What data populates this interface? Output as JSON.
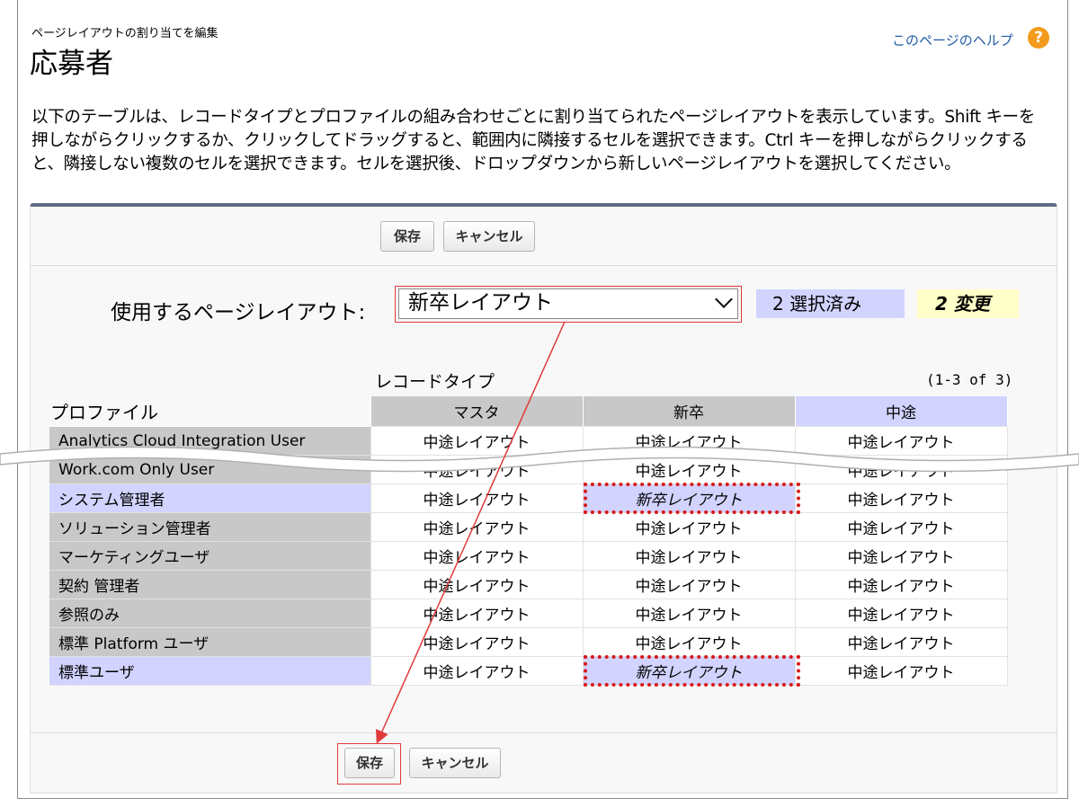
{
  "header": {
    "breadcrumb": "ページレイアウトの割り当てを編集",
    "title": "応募者",
    "help_link": "このページのヘルプ",
    "help_icon": "?"
  },
  "description": "以下のテーブルは、レコードタイプとプロファイルの組み合わせごとに割り当てられたページレイアウトを表示しています。Shift キーを押しながらクリックするか、クリックしてドラッグすると、範囲内に隣接するセルを選択できます。Ctrl キーを押しながらクリックすると、隣接しない複数のセルを選択できます。セルを選択後、ドロップダウンから新しいページレイアウトを選択してください。",
  "buttons": {
    "save": "保存",
    "cancel": "キャンセル"
  },
  "layout_select": {
    "label": "使用するページレイアウト:",
    "value": "新卒レイアウト",
    "selected_badge": "2 選択済み",
    "changed_badge": "2 変更"
  },
  "grid": {
    "record_type_label": "レコードタイプ",
    "count_label": "(1-3 of 3)",
    "profile_header": "プロファイル",
    "columns": [
      "マスタ",
      "新卒",
      "中途"
    ],
    "rows": [
      {
        "profile": "Analytics Cloud Integration User",
        "cells": [
          "中途レイアウト",
          "中途レイアウト",
          "中途レイアウト"
        ]
      },
      {
        "profile": "Work.com Only User",
        "cells": [
          "中途レイアウト",
          "中途レイアウト",
          "中途レイアウト"
        ]
      },
      {
        "profile": "システム管理者",
        "cells": [
          "中途レイアウト",
          "新卒レイアウト",
          "中途レイアウト"
        ]
      },
      {
        "profile": "ソリューション管理者",
        "cells": [
          "中途レイアウト",
          "中途レイアウト",
          "中途レイアウト"
        ]
      },
      {
        "profile": "マーケティングユーザ",
        "cells": [
          "中途レイアウト",
          "中途レイアウト",
          "中途レイアウト"
        ]
      },
      {
        "profile": "契約 管理者",
        "cells": [
          "中途レイアウト",
          "中途レイアウト",
          "中途レイアウト"
        ]
      },
      {
        "profile": "参照のみ",
        "cells": [
          "中途レイアウト",
          "中途レイアウト",
          "中途レイアウト"
        ]
      },
      {
        "profile": "標準 Platform ユーザ",
        "cells": [
          "中途レイアウト",
          "中途レイアウト",
          "中途レイアウト"
        ]
      },
      {
        "profile": "標準ユーザ",
        "cells": [
          "中途レイアウト",
          "新卒レイアウト",
          "中途レイアウト"
        ]
      }
    ]
  },
  "colors": {
    "selected": "#d2d3ff",
    "changed_border": "#d81818",
    "annotation": "#e03b3b",
    "help_icon": "#f29b1d",
    "link": "#1f5ba6"
  }
}
